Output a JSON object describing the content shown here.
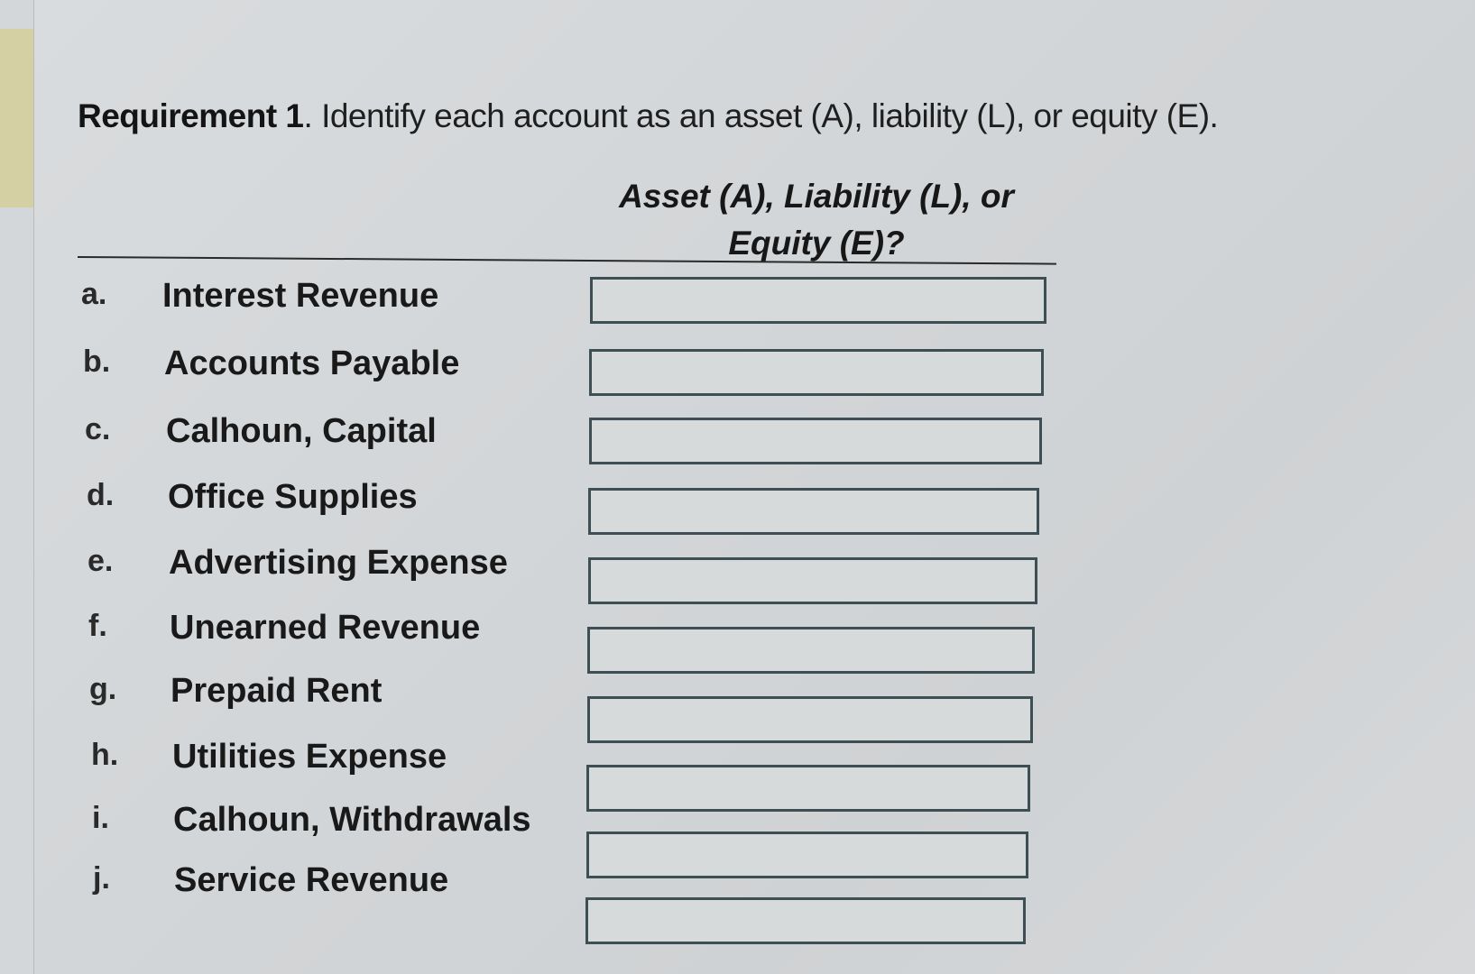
{
  "requirement": {
    "label": "Requirement 1",
    "text": ". Identify each account as an asset (A), liability (L), or equity (E)."
  },
  "column_header": {
    "line1": "Asset (A), Liability (L), or",
    "line2": "Equity (E)?"
  },
  "accounts": [
    {
      "letter": "a.",
      "name": "Interest Revenue",
      "answer": ""
    },
    {
      "letter": "b.",
      "name": "Accounts Payable",
      "answer": ""
    },
    {
      "letter": "c.",
      "name": "Calhoun, Capital",
      "answer": ""
    },
    {
      "letter": "d.",
      "name": "Office Supplies",
      "answer": ""
    },
    {
      "letter": "e.",
      "name": "Advertising Expense",
      "answer": ""
    },
    {
      "letter": "f.",
      "name": "Unearned Revenue",
      "answer": ""
    },
    {
      "letter": "g.",
      "name": "Prepaid Rent",
      "answer": ""
    },
    {
      "letter": "h.",
      "name": "Utilities Expense",
      "answer": ""
    },
    {
      "letter": "i.",
      "name": "Calhoun, Withdrawals",
      "answer": ""
    },
    {
      "letter": "j.",
      "name": "Service Revenue",
      "answer": ""
    }
  ]
}
